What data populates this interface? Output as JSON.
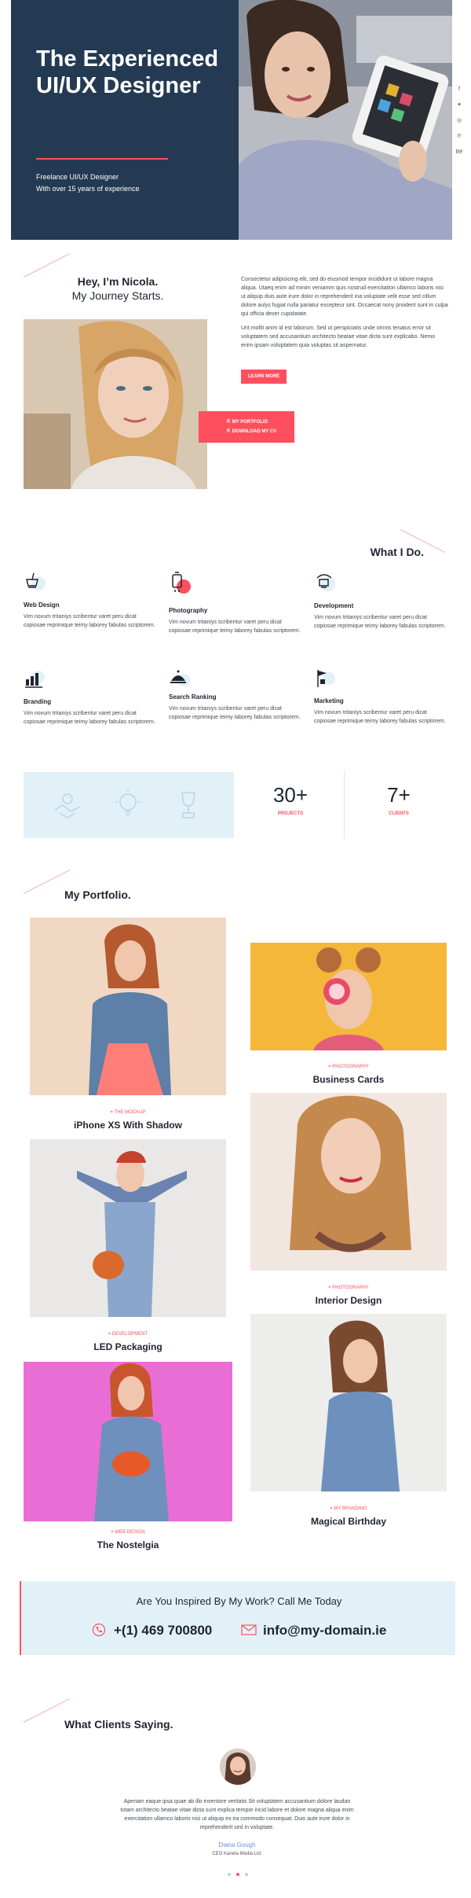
{
  "hero": {
    "title": "The Experienced UI/UX Designer",
    "subtitle_line1": "Freelance UI/UX Designer",
    "subtitle_line2": "With over 15 years of experience",
    "bg_color": "#243a53",
    "accent_color": "#ff4f5e"
  },
  "social": [
    "facebook-icon",
    "twitter-icon",
    "instagram-icon",
    "pinterest-icon",
    "behance-icon"
  ],
  "about": {
    "heading_line1": "Hey, I’m Nicola.",
    "heading_line2": "My Journey Starts.",
    "paragraph1": "Consectetur adipisicing elit, sed do eiusmod tempor incididunt ut labore magna aliqua. Utaeq enim ad minim veniamm quis nostrud exercitation ullamco laboris nisi ut aliquip duis aute irure dolor in reprehenderit ina voluptate velit esse sed cillum dolore aulys fugiat nulla pariatur excepteur sint. Occaecat nony proident sunt in culpa qui officia deser cupidatate.",
    "paragraph2": "Unt mollit anim id est laborum. Sed ut perspiciatis unde omnis tenatus error sit voluptatem sed accusantium architecto beatae vitae dicta sunt explicabo. Nemo enim ipsam voluptatem quia voluptas sit aspernatur.",
    "learn_more": "LEARN MORE",
    "portfolio_link": "MY PORTFOLIO",
    "download_link": "DOWNLOAD MY CV"
  },
  "services": {
    "title": "What I Do.",
    "items": [
      {
        "name": "Web Design",
        "icon": "web-design-icon",
        "desc": "Vim novum tritaniys scribentur varet peru dicat copiosae reprimique teimy laborey fabulas scriptorem."
      },
      {
        "name": "Photography",
        "icon": "photography-icon",
        "desc": "Vim novum tritaniys scribentur varet peru dicat copiosae reprimique teimy laborey fabulas scriptorem."
      },
      {
        "name": "Development",
        "icon": "development-icon",
        "desc": "Vim novum tritaniys scribentur varet peru dicat copiosae reprimique teimy laborey fabulas scriptorem."
      },
      {
        "name": "Branding",
        "icon": "branding-icon",
        "desc": "Vim novum tritaniys scribentur varet peru dicat copiosae reprimique teimy laborey fabulas scriptorem."
      },
      {
        "name": "Search Ranking",
        "icon": "search-ranking-icon",
        "desc": "Vim novum tritaniys scribentur varet peru dicat copiosae reprimique teimy laborey fabulas scriptorem."
      },
      {
        "name": "Marketing",
        "icon": "marketing-icon",
        "desc": "Vim novum tritaniys scribentur varet peru dicat copiosae reprimique teimy laborey fabulas scriptorem."
      }
    ]
  },
  "stats": {
    "icons": [
      "handshake-icon",
      "lightbulb-icon",
      "trophy-icon"
    ],
    "projects_value": "30+",
    "projects_label": "PROJECTS",
    "clients_value": "7+",
    "clients_label": "CLIENTS"
  },
  "portfolio": {
    "title": "My Portfolio.",
    "items": [
      {
        "category": "THE MOCKUP",
        "name": "iPhone XS With Shadow"
      },
      {
        "category": "PHOTOGRAPHY",
        "name": "Business Cards"
      },
      {
        "category": "PHOTOGRAPHY",
        "name": "Interior Design"
      },
      {
        "category": "DEVELOPMENT",
        "name": "LED Packaging"
      },
      {
        "category": "MY BRANDING",
        "name": "Magical Birthday"
      },
      {
        "category": "WEB DESIGN",
        "name": "The Nostelgia"
      }
    ]
  },
  "contact": {
    "title": "Are You Inspired By My Work? Call Me Today",
    "phone": "+(1) 469 700800",
    "email": "info@my-domain.ie"
  },
  "testimonials": {
    "title": "What Clients Saying.",
    "quote": "Aperiam eaque ipsa quae ab illo inventore veritatis Sit voluptatem accusantium dolore laudan totam architecto beatae vitae dicta sunt explica tempor incid labore et dolore magna aliqua enim exercitation ullamco laboris nisi ut aliquip ex ea commodo consequat. Duis aute irure dolor in reprehenderit sed in voluptate.",
    "name": "Diana Gough",
    "company": "CEO Kaneta Media Ltd."
  }
}
